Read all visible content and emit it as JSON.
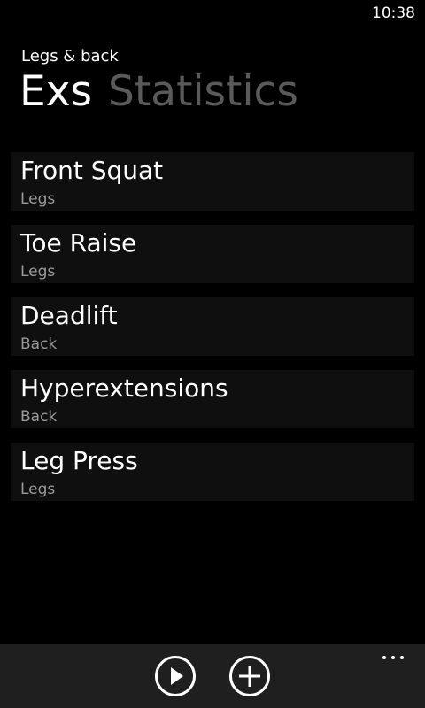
{
  "status_bar": {
    "time": "10:38"
  },
  "app": {
    "title": "Legs & back"
  },
  "pivot": {
    "tabs": [
      {
        "label": "Exs",
        "active": true
      },
      {
        "label": "Statistics",
        "active": false
      }
    ]
  },
  "exercises": [
    {
      "name": "Front Squat",
      "category": "Legs"
    },
    {
      "name": "Toe Raise",
      "category": "Legs"
    },
    {
      "name": "Deadlift",
      "category": "Back"
    },
    {
      "name": "Hyperextensions",
      "category": "Back"
    },
    {
      "name": "Leg Press",
      "category": "Legs"
    }
  ],
  "app_bar": {
    "buttons": [
      {
        "icon": "play-icon"
      },
      {
        "icon": "add-icon"
      }
    ],
    "more_icon": "ellipsis-icon"
  },
  "colors": {
    "background": "#000000",
    "item_background": "#0f0f0f",
    "app_bar_background": "#1f1f1f",
    "inactive_tab": "#5a5a5a",
    "secondary_text": "#9b9b9b"
  }
}
